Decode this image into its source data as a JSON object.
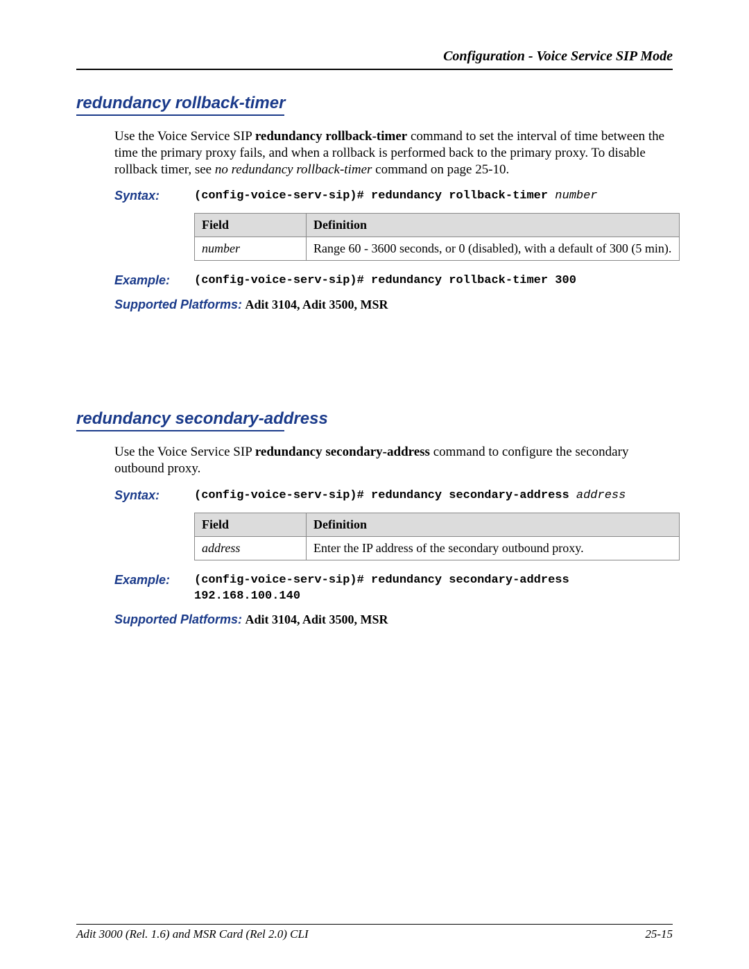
{
  "header": {
    "breadcrumb": "Configuration - Voice Service SIP Mode"
  },
  "section1": {
    "heading": "redundancy rollback-timer",
    "intro_pre": "Use the Voice Service SIP ",
    "intro_bold": "redundancy rollback-timer",
    "intro_mid": " command to set the interval of time between the time the primary proxy fails, and when a rollback is performed back to the primary proxy. To disable rollback timer, see ",
    "intro_ital": "no redundancy rollback-timer",
    "intro_post": " command on page 25-10.",
    "syntax_label": "Syntax:",
    "syntax_cmd": "(config-voice-serv-sip)# redundancy rollback-timer ",
    "syntax_param": "number",
    "table": {
      "h1": "Field",
      "h2": "Definition",
      "r1c1": "number",
      "r1c2": "Range 60 - 3600 seconds, or 0 (disabled), with a default of 300 (5 min)."
    },
    "example_label": "Example:",
    "example_cmd": "(config-voice-serv-sip)# redundancy rollback-timer 300",
    "supported_label": "Supported Platforms:",
    "supported_value": " Adit 3104, Adit 3500, MSR"
  },
  "section2": {
    "heading": "redundancy secondary-address",
    "intro_pre": "Use the Voice Service SIP ",
    "intro_bold": "redundancy secondary-address",
    "intro_post": " command to configure the secondary outbound proxy.",
    "syntax_label": "Syntax:",
    "syntax_cmd": "(config-voice-serv-sip)# redundancy secondary-address ",
    "syntax_param": "address",
    "table": {
      "h1": "Field",
      "h2": "Definition",
      "r1c1": "address",
      "r1c2": "Enter the IP address of the secondary outbound proxy."
    },
    "example_label": "Example:",
    "example_cmd": "(config-voice-serv-sip)# redundancy secondary-address 192.168.100.140",
    "supported_label": "Supported Platforms:",
    "supported_value": " Adit 3104, Adit 3500, MSR"
  },
  "footer": {
    "left": "Adit 3000 (Rel. 1.6) and MSR Card (Rel 2.0) CLI",
    "right": "25-15"
  }
}
